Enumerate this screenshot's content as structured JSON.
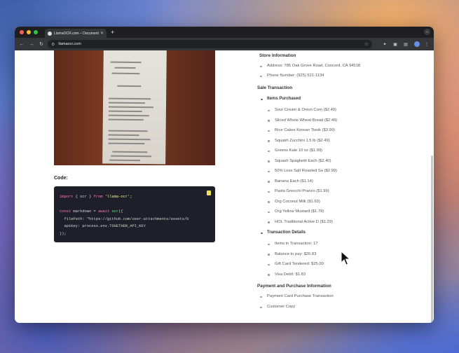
{
  "browser": {
    "tab_title": "LlamaOCR.com – Document",
    "new_tab_symbol": "+",
    "url": "llamaocr.com"
  },
  "code_section": {
    "label": "Code:",
    "lines": [
      [
        "import",
        " { ocr } ",
        "from",
        " 'llama-ocr';"
      ],
      [
        "const",
        " markdown = ",
        "await",
        " ",
        "ocr",
        "({"
      ],
      [
        "  filePath: \"https://github.com/user-attachments/assets/b"
      ],
      [
        "  apiKey: process.env.TOGETHER_API_KEY"
      ],
      [
        "});"
      ]
    ]
  },
  "result": {
    "store_information": {
      "title": "Store Information",
      "items": [
        "Address: 785 Oak Grove Road, Concord, CA 94518",
        "Phone Number: (925) 521-1134"
      ]
    },
    "sale_transaction": {
      "title": "Sale Transaction",
      "items_purchased": {
        "title": "Items Purchased",
        "items": [
          "Sour Cream & Onion Corn ($2.49)",
          "Sliced Whole Wheat Bread ($2.49)",
          "Rice Cakes Korean Tteok ($3.99)",
          "Squash Zucchini 1.5 lb ($2.49)",
          "Greens Kale 10 oz ($1.99)",
          "Squash Spaghetti Each ($2.40)",
          "50% Less Salt Roasted Sa ($2.99)",
          "Banana Each ($1.14)",
          "Pasta Gnocchi Pranzo ($1.99)",
          "Org Coconut Milk ($1.69)",
          "Org Yellow Mustard ($1.79)",
          "HOL Traditional Active D ($1.29)"
        ]
      },
      "transaction_details": {
        "title": "Transaction Details",
        "items": [
          "Items in Transaction: 17",
          "Balance to pay: $26.83",
          "Gift Card Tendered: $25.00",
          "Visa Debit: $1.83"
        ]
      }
    },
    "payment": {
      "title": "Payment and Purchase Information",
      "items": [
        "Payment Card Purchase Transaction",
        "Customer Copy"
      ]
    }
  }
}
